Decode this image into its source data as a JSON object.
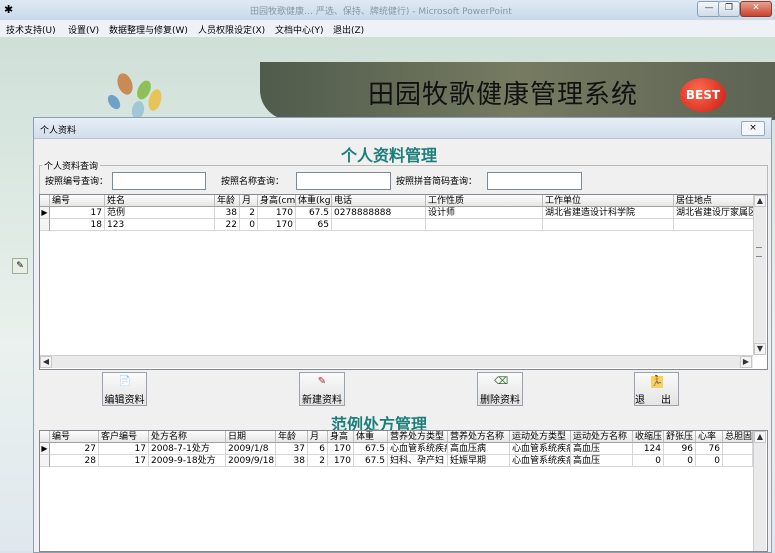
{
  "window": {
    "app_title": "田园牧歌健康…  严选、保持、牌统健行)  - Microsoft PowerPoint",
    "minimize_icon": "minimize-icon",
    "restore_icon": "restore-icon",
    "close_icon": "close-icon",
    "minimize_glyph": "—",
    "restore_glyph": "❐",
    "close_glyph": "✕"
  },
  "menu": {
    "items": [
      "技术支持(U)",
      "设置(V)",
      "数据整理与修复(W)",
      "人员权限设定(X)",
      "文档中心(Y)",
      "退出(Z)"
    ]
  },
  "banner": {
    "title": "田园牧歌健康管理系统",
    "badge": "BEST"
  },
  "child": {
    "title": "个人资料",
    "close_glyph": "×",
    "section_title": "个人资料管理",
    "query": {
      "legend": "个人资料查询",
      "by_id_label": "按照编号查询：",
      "by_id_value": "",
      "by_name_label": "按照名称查询：",
      "by_name_value": "",
      "by_pinyin_label": "按照拼音简码查询：",
      "by_pinyin_value": ""
    },
    "person_grid": {
      "columns": [
        "编号",
        "姓名",
        "年龄",
        "月",
        "身高(cm)",
        "体重(kg)",
        "电话",
        "工作性质",
        "工作单位",
        "居住地点"
      ],
      "rows": [
        [
          "17",
          "范例",
          "38",
          "2",
          "170",
          "67.5",
          "0278888888",
          "设计师",
          "湖北省建造设计科学院",
          "湖北省建设厅家属区"
        ],
        [
          "18",
          "123",
          "22",
          "0",
          "170",
          "65",
          "",
          "",
          "",
          ""
        ]
      ],
      "selected_marker": "▶"
    },
    "buttons": {
      "edit": "编辑资料",
      "new": "新建资料",
      "delete": "删除资料",
      "exit": "退出"
    },
    "icons": {
      "edit": "edit-document-icon",
      "new": "new-document-icon",
      "delete": "delete-document-icon",
      "exit": "exit-person-icon"
    },
    "prescription_title": "范例处方管理",
    "prescription_grid": {
      "columns": [
        "编号",
        "客户编号",
        "处方名称",
        "日期",
        "年龄",
        "月",
        "身高",
        "体重",
        "营养处方类型",
        "营养处方名称",
        "运动处方类型",
        "运动处方名称",
        "收缩压",
        "舒张压",
        "心率",
        "总胆固"
      ],
      "rows": [
        [
          "27",
          "17",
          "2008-7-1处方",
          "2009/1/8",
          "37",
          "6",
          "170",
          "67.5",
          "心血管系统疾病",
          "高血压病",
          "心血管系统疾病",
          "高血压",
          "124",
          "96",
          "76",
          ""
        ],
        [
          "28",
          "17",
          "2009-9-18处方",
          "2009/9/18",
          "38",
          "2",
          "170",
          "67.5",
          "妇科、孕产妇",
          "妊娠早期",
          "心血管系统疾病",
          "高血压",
          "0",
          "0",
          "0",
          ""
        ]
      ],
      "selected_marker": "▶"
    }
  },
  "colors": {
    "section_title": "#1c7f7a",
    "banner": "#5c6353",
    "badge": "#c81a12"
  }
}
